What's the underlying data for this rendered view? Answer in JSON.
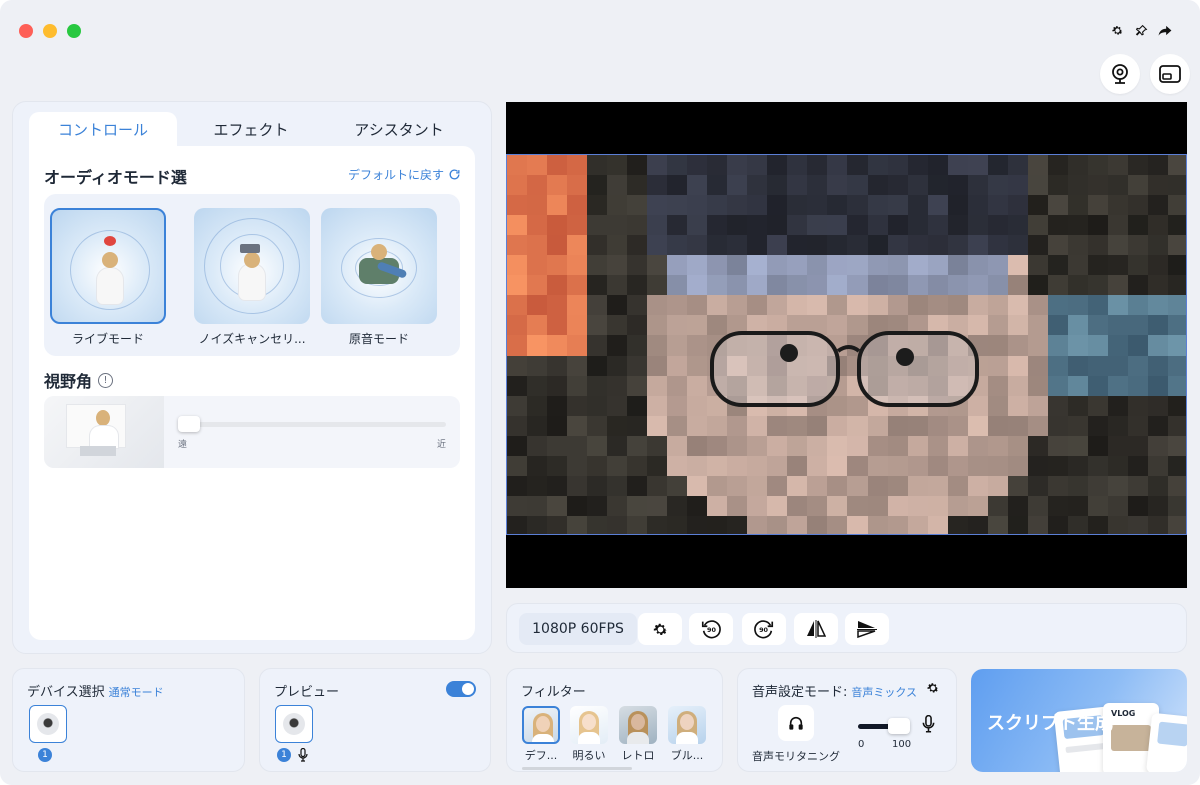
{
  "tabs": [
    {
      "label": "コントロール",
      "active": true
    },
    {
      "label": "エフェクト",
      "active": false
    },
    {
      "label": "アシスタント",
      "active": false
    }
  ],
  "audio_mode": {
    "title": "オーディオモード選",
    "reset_label": "デフォルトに戻す",
    "modes": [
      {
        "label": "ライブモード",
        "selected": true
      },
      {
        "label": "ノイズキャンセリ...",
        "selected": false
      },
      {
        "label": "原音モード",
        "selected": false
      }
    ]
  },
  "fov": {
    "title": "視野角",
    "far_label": "遠",
    "near_label": "近",
    "value": 0.0
  },
  "control_bar": {
    "resolution": "1080P 60FPS",
    "rotate_left_label": "90",
    "rotate_right_label": "90"
  },
  "device": {
    "title": "デバイス選択",
    "mode": "通常モード",
    "count": "1"
  },
  "preview_card": {
    "title": "プレビュー",
    "count": "1",
    "enabled": true
  },
  "filters": {
    "title": "フィルター",
    "items": [
      {
        "label": "デフ...",
        "selected": true
      },
      {
        "label": "明るい",
        "selected": false
      },
      {
        "label": "レトロ",
        "selected": false
      },
      {
        "label": "ブル...",
        "selected": false
      }
    ]
  },
  "audio_settings": {
    "title": "音声設定モード:",
    "mode": "音声ミックス",
    "monitoring_label": "音声モリタニング",
    "vol_min": "0",
    "vol_max": "100",
    "volume": 100
  },
  "script_button": {
    "label": "スクリプト生成",
    "phone_caption": "VLOG"
  },
  "colors": {
    "accent": "#3b82d8",
    "background": "#eef0f5",
    "panel": "#eef2fa"
  },
  "icons": {
    "top_bar": [
      "gear-icon",
      "pin-icon",
      "share-arrow-icon"
    ],
    "round_buttons": [
      "webcam-icon",
      "cast-icon"
    ]
  }
}
